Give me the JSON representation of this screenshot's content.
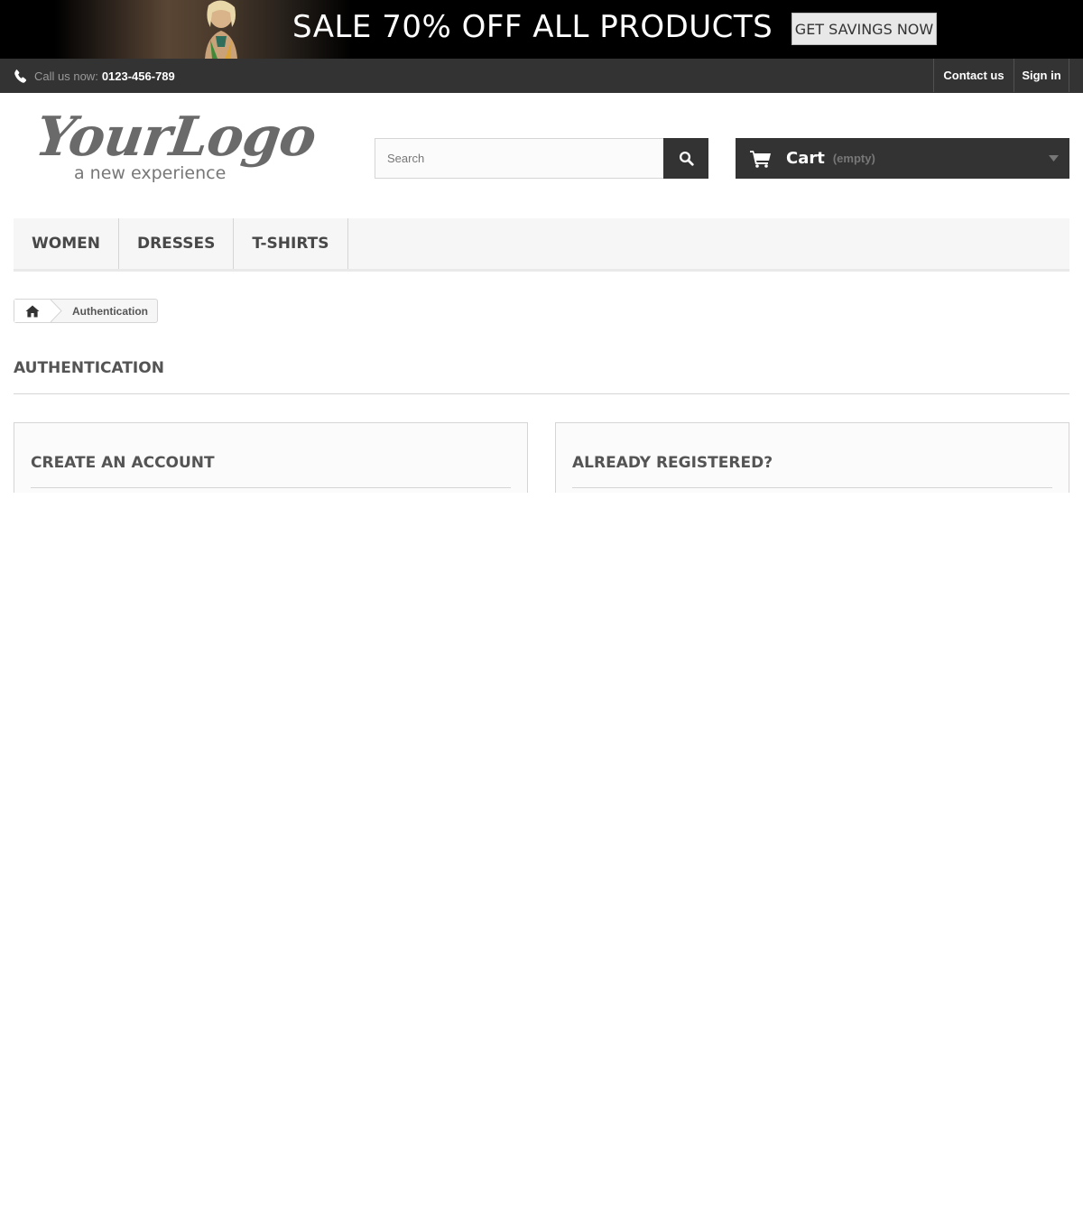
{
  "banner": {
    "headline": "SALE 70% OFF ALL PRODUCTS",
    "cta_label": "GET SAVINGS NOW"
  },
  "topbar": {
    "phone_prefix": "Call us now:",
    "phone_number": "0123-456-789",
    "contact_label": "Contact us",
    "signin_label": "Sign in"
  },
  "logo": {
    "script_text": "YourLogo",
    "tagline": "a new experience"
  },
  "search": {
    "placeholder": "Search"
  },
  "cart": {
    "label": "Cart",
    "status": "(empty)"
  },
  "menu": {
    "items": [
      {
        "label": "WOMEN"
      },
      {
        "label": "DRESSES"
      },
      {
        "label": "T-SHIRTS"
      }
    ]
  },
  "breadcrumb": {
    "current": "Authentication"
  },
  "page": {
    "heading": "AUTHENTICATION"
  },
  "boxes": {
    "create_title": "CREATE AN ACCOUNT",
    "registered_title": "ALREADY REGISTERED?"
  },
  "icons": {
    "phone": "phone-icon",
    "search": "search-icon",
    "cart": "cart-icon",
    "caret": "caret-down-icon",
    "home": "home-icon"
  },
  "colors": {
    "dark_bar": "#333333",
    "menu_bg": "#f6f6f6",
    "border": "#d6d4d4",
    "heading": "#555454"
  }
}
